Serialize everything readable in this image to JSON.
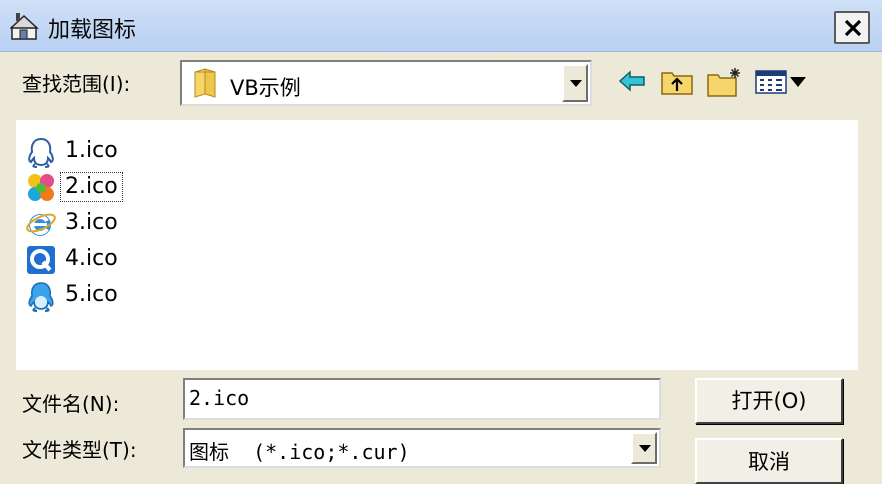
{
  "window": {
    "title": "加载图标"
  },
  "look_in": {
    "label": "查找范围(I):",
    "value": "VB示例"
  },
  "files": [
    {
      "name": "1.ico",
      "icon": "qq-penguin-outline-icon"
    },
    {
      "name": "2.ico",
      "icon": "colorful-flower-icon",
      "selected": true
    },
    {
      "name": "3.ico",
      "icon": "internet-explorer-icon"
    },
    {
      "name": "4.ico",
      "icon": "q-letter-icon"
    },
    {
      "name": "5.ico",
      "icon": "qq-penguin-blue-icon"
    }
  ],
  "filename": {
    "label": "文件名(N):",
    "value": "2.ico"
  },
  "filetype": {
    "label": "文件类型(T):",
    "value": "图标  (*.ico;*.cur)"
  },
  "buttons": {
    "open": "打开(O)",
    "cancel": "取消"
  }
}
